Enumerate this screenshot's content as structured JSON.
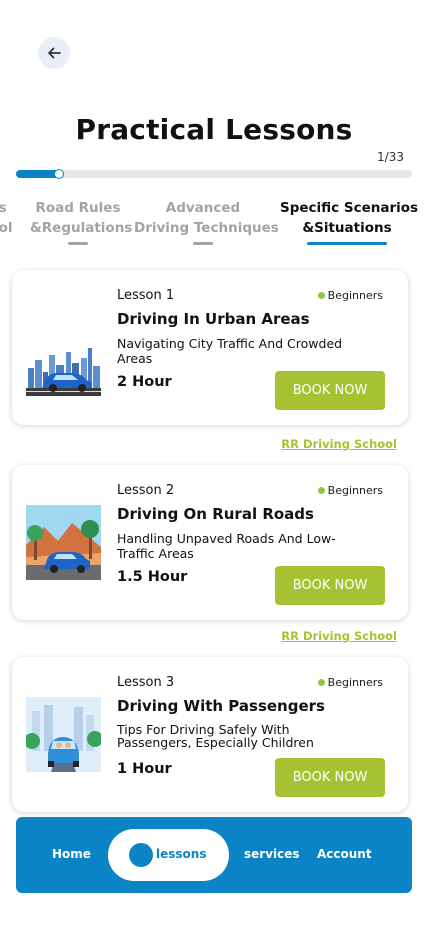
{
  "header": {
    "title": "Practical Lessons",
    "counter": "1/33",
    "progress": 0.03
  },
  "tabs": [
    {
      "line1": "rs",
      "line2": "rol"
    },
    {
      "line1": "Road Rules",
      "line2": "&Regulations"
    },
    {
      "line1": "Advanced",
      "line2": "Driving Techniques"
    },
    {
      "line1": "Specific Scenarios",
      "line2": "&Situations"
    }
  ],
  "lessons": [
    {
      "number": "Lesson 1",
      "level": "Beginners",
      "title": "Driving In Urban Areas",
      "description": "Navigating City Traffic And Crowded Areas",
      "duration": "2 Hour",
      "button": "BOOK NOW",
      "school": "RR Driving School",
      "image": "city-car-illustration"
    },
    {
      "number": "Lesson 2",
      "level": "Beginners",
      "title": "Driving On Rural Roads",
      "description": "Handling Unpaved Roads And Low-Traffic Areas",
      "duration": "1.5 Hour",
      "button": "BOOK NOW",
      "school": "RR Driving School",
      "image": "rural-car-illustration"
    },
    {
      "number": "Lesson 3",
      "level": "Beginners",
      "title": "Driving With Passengers",
      "description": "Tips For Driving Safely  With Passengers, Especially Children",
      "duration": "1 Hour",
      "button": "BOOK NOW",
      "image": "passengers-car-illustration"
    }
  ],
  "nav": {
    "home": "Home",
    "lessons": "lessons",
    "services": "services",
    "account": "Account"
  },
  "colors": {
    "accent": "#0b84c6",
    "button": "#a6c232",
    "level_dot": "#8dc63f"
  }
}
